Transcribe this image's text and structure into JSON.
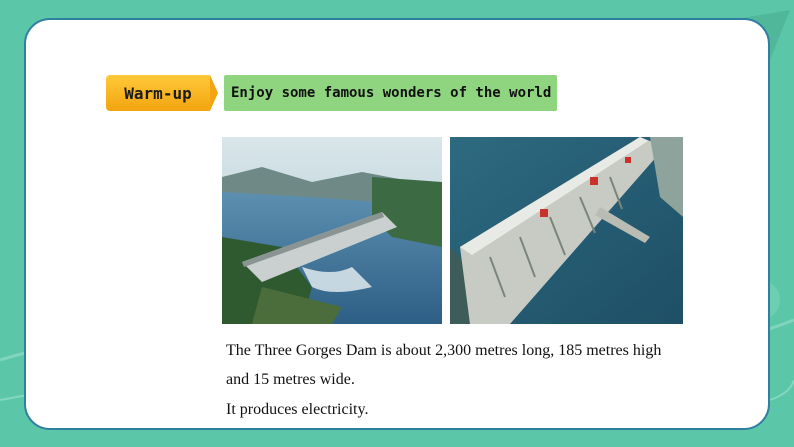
{
  "badge": {
    "label": "Warm-up"
  },
  "header": {
    "title": "Enjoy some famous wonders of the world"
  },
  "photos": [
    {
      "icon": "dam-painting-image"
    },
    {
      "icon": "dam-aerial-photo-image"
    }
  ],
  "caption": {
    "line1": "The Three Gorges Dam is about 2,300 metres long, 185 metres high",
    "line2": "and 15 metres wide.",
    "line3": "It produces electricity."
  },
  "colors": {
    "background": "#5cc7a8",
    "card_border": "#2f7fa0",
    "badge": "#f3a50f",
    "title_bar": "#8fd47e"
  }
}
